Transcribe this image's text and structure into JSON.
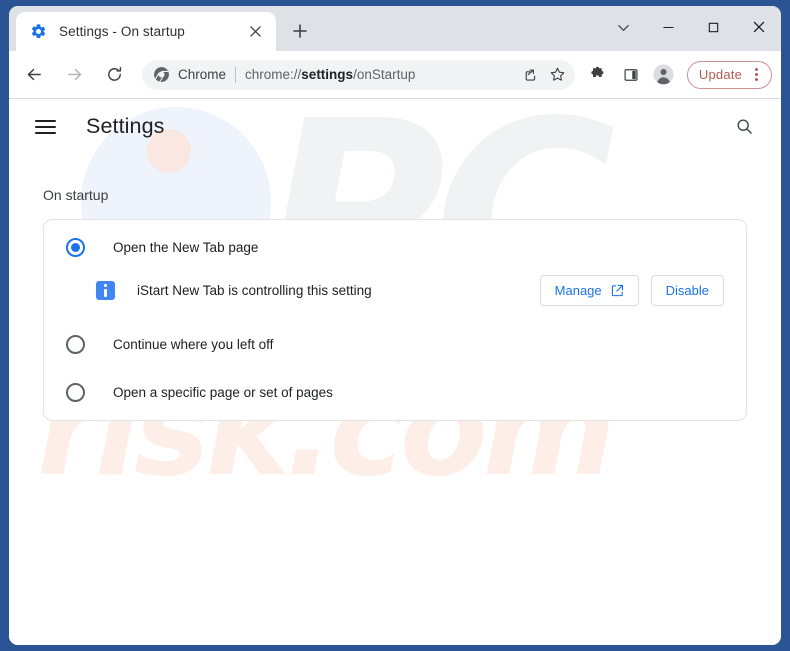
{
  "window": {
    "controls": [
      {
        "name": "tab-search-button",
        "icon": "chevron-down-icon",
        "label": ""
      },
      {
        "name": "minimize-button",
        "icon": "minimize-icon",
        "label": ""
      },
      {
        "name": "maximize-button",
        "icon": "maximize-icon",
        "label": ""
      },
      {
        "name": "close-window-button",
        "icon": "close-icon",
        "label": ""
      }
    ]
  },
  "tab": {
    "title": "Settings - On startup",
    "favicon": "settings-gear-icon",
    "close_icon": "close-icon",
    "new_tab_icon": "plus-icon"
  },
  "toolbar": {
    "back_icon": "arrow-left-icon",
    "forward_icon": "arrow-right-icon",
    "reload_icon": "reload-icon",
    "omnibox": {
      "site_icon": "chrome-icon",
      "scheme_label": "Chrome",
      "url_prefix": "chrome://",
      "url_bold": "settings",
      "url_suffix": "/onStartup",
      "share_icon": "share-icon",
      "bookmark_icon": "star-icon"
    },
    "extensions_icon": "puzzle-piece-icon",
    "side_panel_icon": "side-panel-icon",
    "profile_icon": "avatar-icon",
    "update_label": "Update",
    "update_menu_icon": "three-dots-vertical-icon",
    "update_accent_color": "#b45b55"
  },
  "settings": {
    "menu_icon": "hamburger-menu-icon",
    "title": "Settings",
    "search_icon": "search-icon",
    "section_heading": "On startup",
    "accent_color": "#1a73e8",
    "options": [
      {
        "label": "Open the New Tab page",
        "checked": true
      },
      {
        "label": "Continue where you left off",
        "checked": false
      },
      {
        "label": "Open a specific page or set of pages",
        "checked": false
      }
    ],
    "extension_notice": {
      "icon": "info-icon",
      "message": "iStart New Tab is controlling this setting",
      "manage_label": "Manage",
      "manage_icon": "external-link-icon",
      "disable_label": "Disable"
    }
  },
  "watermark": {
    "top_text": "PC",
    "bottom_text": "risk.com"
  }
}
